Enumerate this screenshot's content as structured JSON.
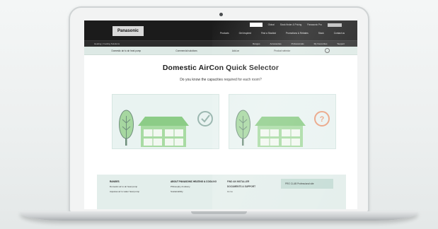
{
  "header": {
    "logo": "Panasonic",
    "utility": [
      "Global",
      "Stock finder & Pricing",
      "Panasonic Pro"
    ],
    "main_nav": [
      "Products",
      "Get Inspired",
      "Find a Stockist",
      "Promotions & Rebates",
      "Stock",
      "Contact us"
    ],
    "breadcrumb": "Heating | Cooling Solutions",
    "sub_nav": [
      "Ranges",
      "Accessories",
      "Professionals",
      "My Favourites",
      "Support"
    ]
  },
  "tabs": [
    "Domestic air to air heat pump",
    "Commercial solutions",
    "Add-on",
    "Product selector"
  ],
  "main": {
    "title": "Domestic AirCon Quick Selector",
    "question": "Do you know the capacities required for each room?"
  },
  "footer": {
    "col1": {
      "heading": "RANGES",
      "links": [
        "Domestic air to air heat pump",
        "Aquarea air to water heat pump"
      ]
    },
    "col2": {
      "heading": "ABOUT PANASONIC HEATING & COOLING",
      "links": [
        "Philosophy & History",
        "Sustainability"
      ]
    },
    "col3": {
      "heading": "FIND AN INSTALLER",
      "links": [
        "DOCUMENTS & SUPPORT",
        "Home"
      ]
    },
    "pro_club": "PRO CLUB Professional site"
  },
  "colors": {
    "accent_check": "#9bb7b0",
    "accent_question": "#e9a07f",
    "house_green": "#9fd39a",
    "card_bg": "#e9f3f1"
  }
}
